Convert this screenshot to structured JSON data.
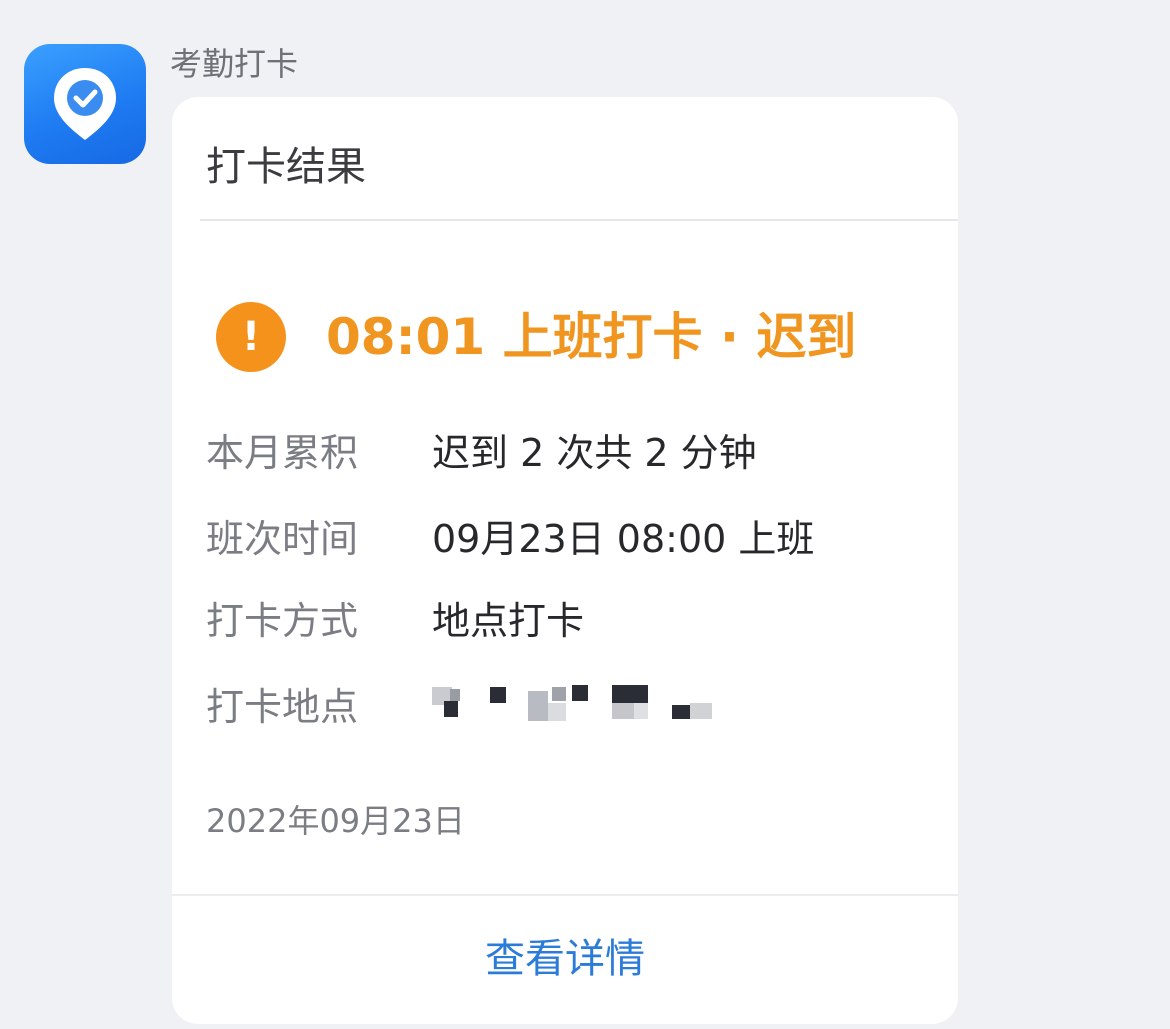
{
  "app": {
    "name": "考勤打卡",
    "icon": "location-check-icon",
    "brand_color": "#1f7cf2"
  },
  "card": {
    "title": "打卡结果",
    "result": {
      "icon": "warning-exclamation-icon",
      "icon_symbol": "!",
      "text": "08:01 上班打卡 · 迟到",
      "color": "#f0951f"
    },
    "rows": [
      {
        "label": "本月累积",
        "value": "迟到 2 次共 2 分钟"
      },
      {
        "label": "班次时间",
        "value": "09月23日 08:00 上班"
      },
      {
        "label": "打卡方式",
        "value": "地点打卡"
      },
      {
        "label": "打卡地点",
        "value": ""
      }
    ],
    "date": "2022年09月23日",
    "link_label": "查看详情",
    "link_color": "#2b7cd8"
  }
}
